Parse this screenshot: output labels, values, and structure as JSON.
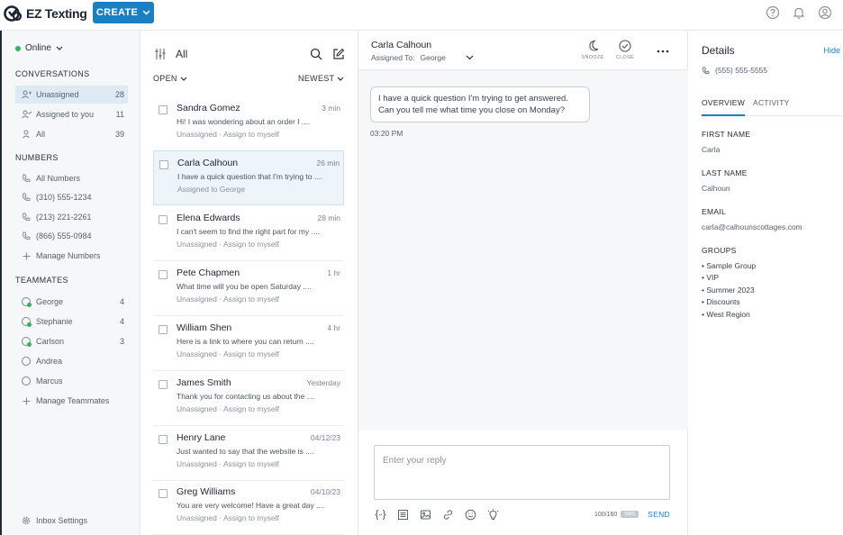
{
  "app": {
    "name": "EZ Texting",
    "create_label": "CREATE"
  },
  "sidebar": {
    "status": "Online",
    "conversations_title": "CONVERSATIONS",
    "conversations": [
      {
        "label": "Unassigned",
        "count": "28",
        "active": true
      },
      {
        "label": "Assigned to you",
        "count": "11"
      },
      {
        "label": "All",
        "count": "39"
      }
    ],
    "numbers_title": "NUMBERS",
    "numbers": [
      {
        "label": "All Numbers"
      },
      {
        "label": "(310) 555-1234"
      },
      {
        "label": "(213) 221-2261"
      },
      {
        "label": "(866) 555-0984"
      },
      {
        "label": "Manage Numbers"
      }
    ],
    "teammates_title": "TEAMMATES",
    "teammates": [
      {
        "label": "George",
        "count": "4",
        "online": true
      },
      {
        "label": "Stephanie",
        "count": "4",
        "online": true
      },
      {
        "label": "Carlson",
        "count": "3",
        "online": true
      },
      {
        "label": "Andrea",
        "count": ""
      },
      {
        "label": "Marcus",
        "count": ""
      },
      {
        "label": "Manage Teammates",
        "count": ""
      }
    ],
    "settings_label": "Inbox Settings"
  },
  "list": {
    "title": "All",
    "filter_left": "OPEN",
    "filter_right": "NEWEST",
    "items": [
      {
        "name": "Sandra Gomez",
        "time": "3 min",
        "message": "Hi! I was wondering about an order I ....",
        "status": "Unassigned · Assign to myself"
      },
      {
        "name": "Carla Calhoun",
        "time": "26 min",
        "message": "I have a quick question that I'm trying to ....",
        "status": "Assigned to George",
        "selected": true
      },
      {
        "name": "Elena Edwards",
        "time": "28 min",
        "message": "I can't seem to find the right part for my ....",
        "status": "Unassigned · Assign to myself"
      },
      {
        "name": "Pete Chapmen",
        "time": "1 hr",
        "message": "What time will you be open Saturday ....",
        "status": "Unassigned · Assign to myself"
      },
      {
        "name": "William Shen",
        "time": "4 hr",
        "message": "Here is a link to where you can return ....",
        "status": "Unassigned · Assign to myself"
      },
      {
        "name": "James Smith",
        "time": "Yesterday",
        "message": "Thank you for contacting us about the ....",
        "status": "Unassigned · Assign to myself"
      },
      {
        "name": "Henry Lane",
        "time": "04/12/23",
        "message": "Just wanted to say that the website is ....",
        "status": "Unassigned · Assign to myself"
      },
      {
        "name": "Greg Williams",
        "time": "04/10/23",
        "message": "You are very welcome! Have a great day ....",
        "status": "Unassigned · Assign to myself"
      }
    ]
  },
  "chat": {
    "contact": "Carla Calhoun",
    "assigned_label": "Assigned To:",
    "assigned_value": "George",
    "snooze_label": "SNOOZE",
    "close_label": "CLOSE",
    "message": "I have a quick question I'm trying to get answered. Can you tell me what time you close on Monday?",
    "message_time": "03:20 PM",
    "reply_placeholder": "Enter your reply",
    "counter": "100/160",
    "sms_badge": "SMS",
    "send_label": "SEND"
  },
  "details": {
    "title": "Details",
    "hide_label": "Hide",
    "phone": "(555) 555-5555",
    "tab_overview": "OVERVIEW",
    "tab_activity": "ACTIVITY",
    "first_name_label": "FIRST NAME",
    "first_name": "Carla",
    "last_name_label": "LAST NAME",
    "last_name": "Calhoun",
    "email_label": "EMAIL",
    "email": "carla@calhounscottages.com",
    "groups_label": "GROUPS",
    "groups": [
      "• Sample Group",
      "• VIP",
      "• Summer 2023",
      "• Discounts",
      "• West Region"
    ]
  },
  "colors": {
    "accent": "#1b7fc4",
    "online": "#34b45a",
    "sidebar_bg": "#f6f7f8"
  }
}
